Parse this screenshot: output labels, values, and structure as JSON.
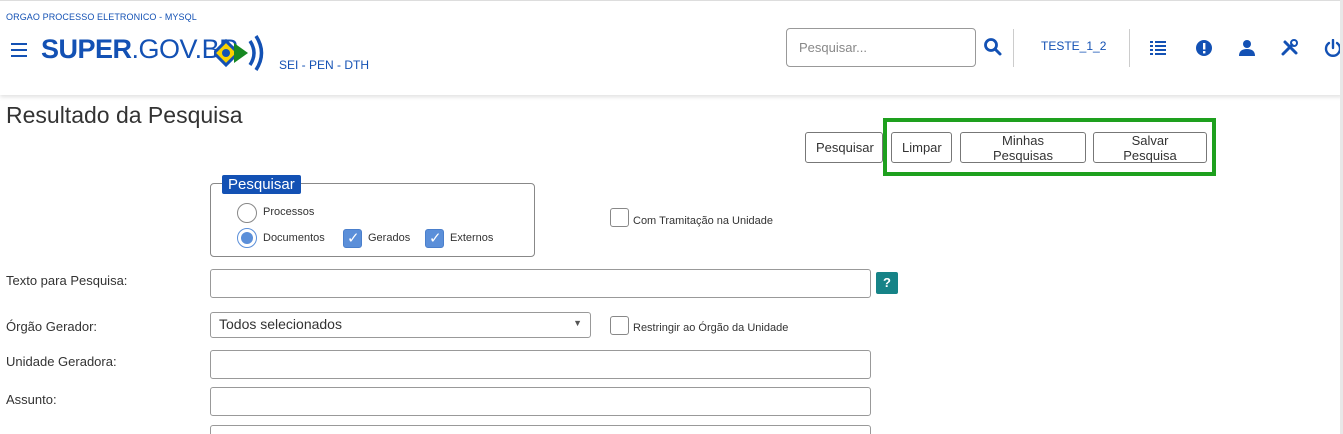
{
  "header": {
    "org_name": "ORGAO PROCESSO ELETRONICO - MYSQL",
    "logo_bold": "SUPER",
    "logo_thin": ".GOV.BR",
    "subsystem": "SEI - PEN - DTH",
    "search_placeholder": "Pesquisar...",
    "user_unit": "TESTE_1_2",
    "icons": [
      "menu-icon",
      "search-icon",
      "list-icon",
      "alert-icon",
      "user-icon",
      "tools-icon",
      "power-icon"
    ],
    "brand_color": "#1351b4"
  },
  "page": {
    "title": "Resultado da Pesquisa",
    "buttons": {
      "pesquisar": "Pesquisar",
      "limpar": "Limpar",
      "minhas": "Minhas Pesquisas",
      "salvar": "Salvar Pesquisa"
    },
    "highlight_color": "#1ea01e"
  },
  "search_scope": {
    "legend": "Pesquisar",
    "processos": "Processos",
    "documentos": "Documentos",
    "gerados": "Gerados",
    "externos": "Externos",
    "selected": "Documentos",
    "gerados_checked": true,
    "externos_checked": true
  },
  "options": {
    "com_tramitacao": "Com Tramitação na Unidade",
    "restringir": "Restringir ao Órgão da Unidade"
  },
  "fields": {
    "texto_label": "Texto para Pesquisa:",
    "texto_value": "",
    "orgao_label": "Órgão Gerador:",
    "orgao_value": "Todos selecionados",
    "unidade_label": "Unidade Geradora:",
    "assunto_label": "Assunto:",
    "help": "?"
  }
}
